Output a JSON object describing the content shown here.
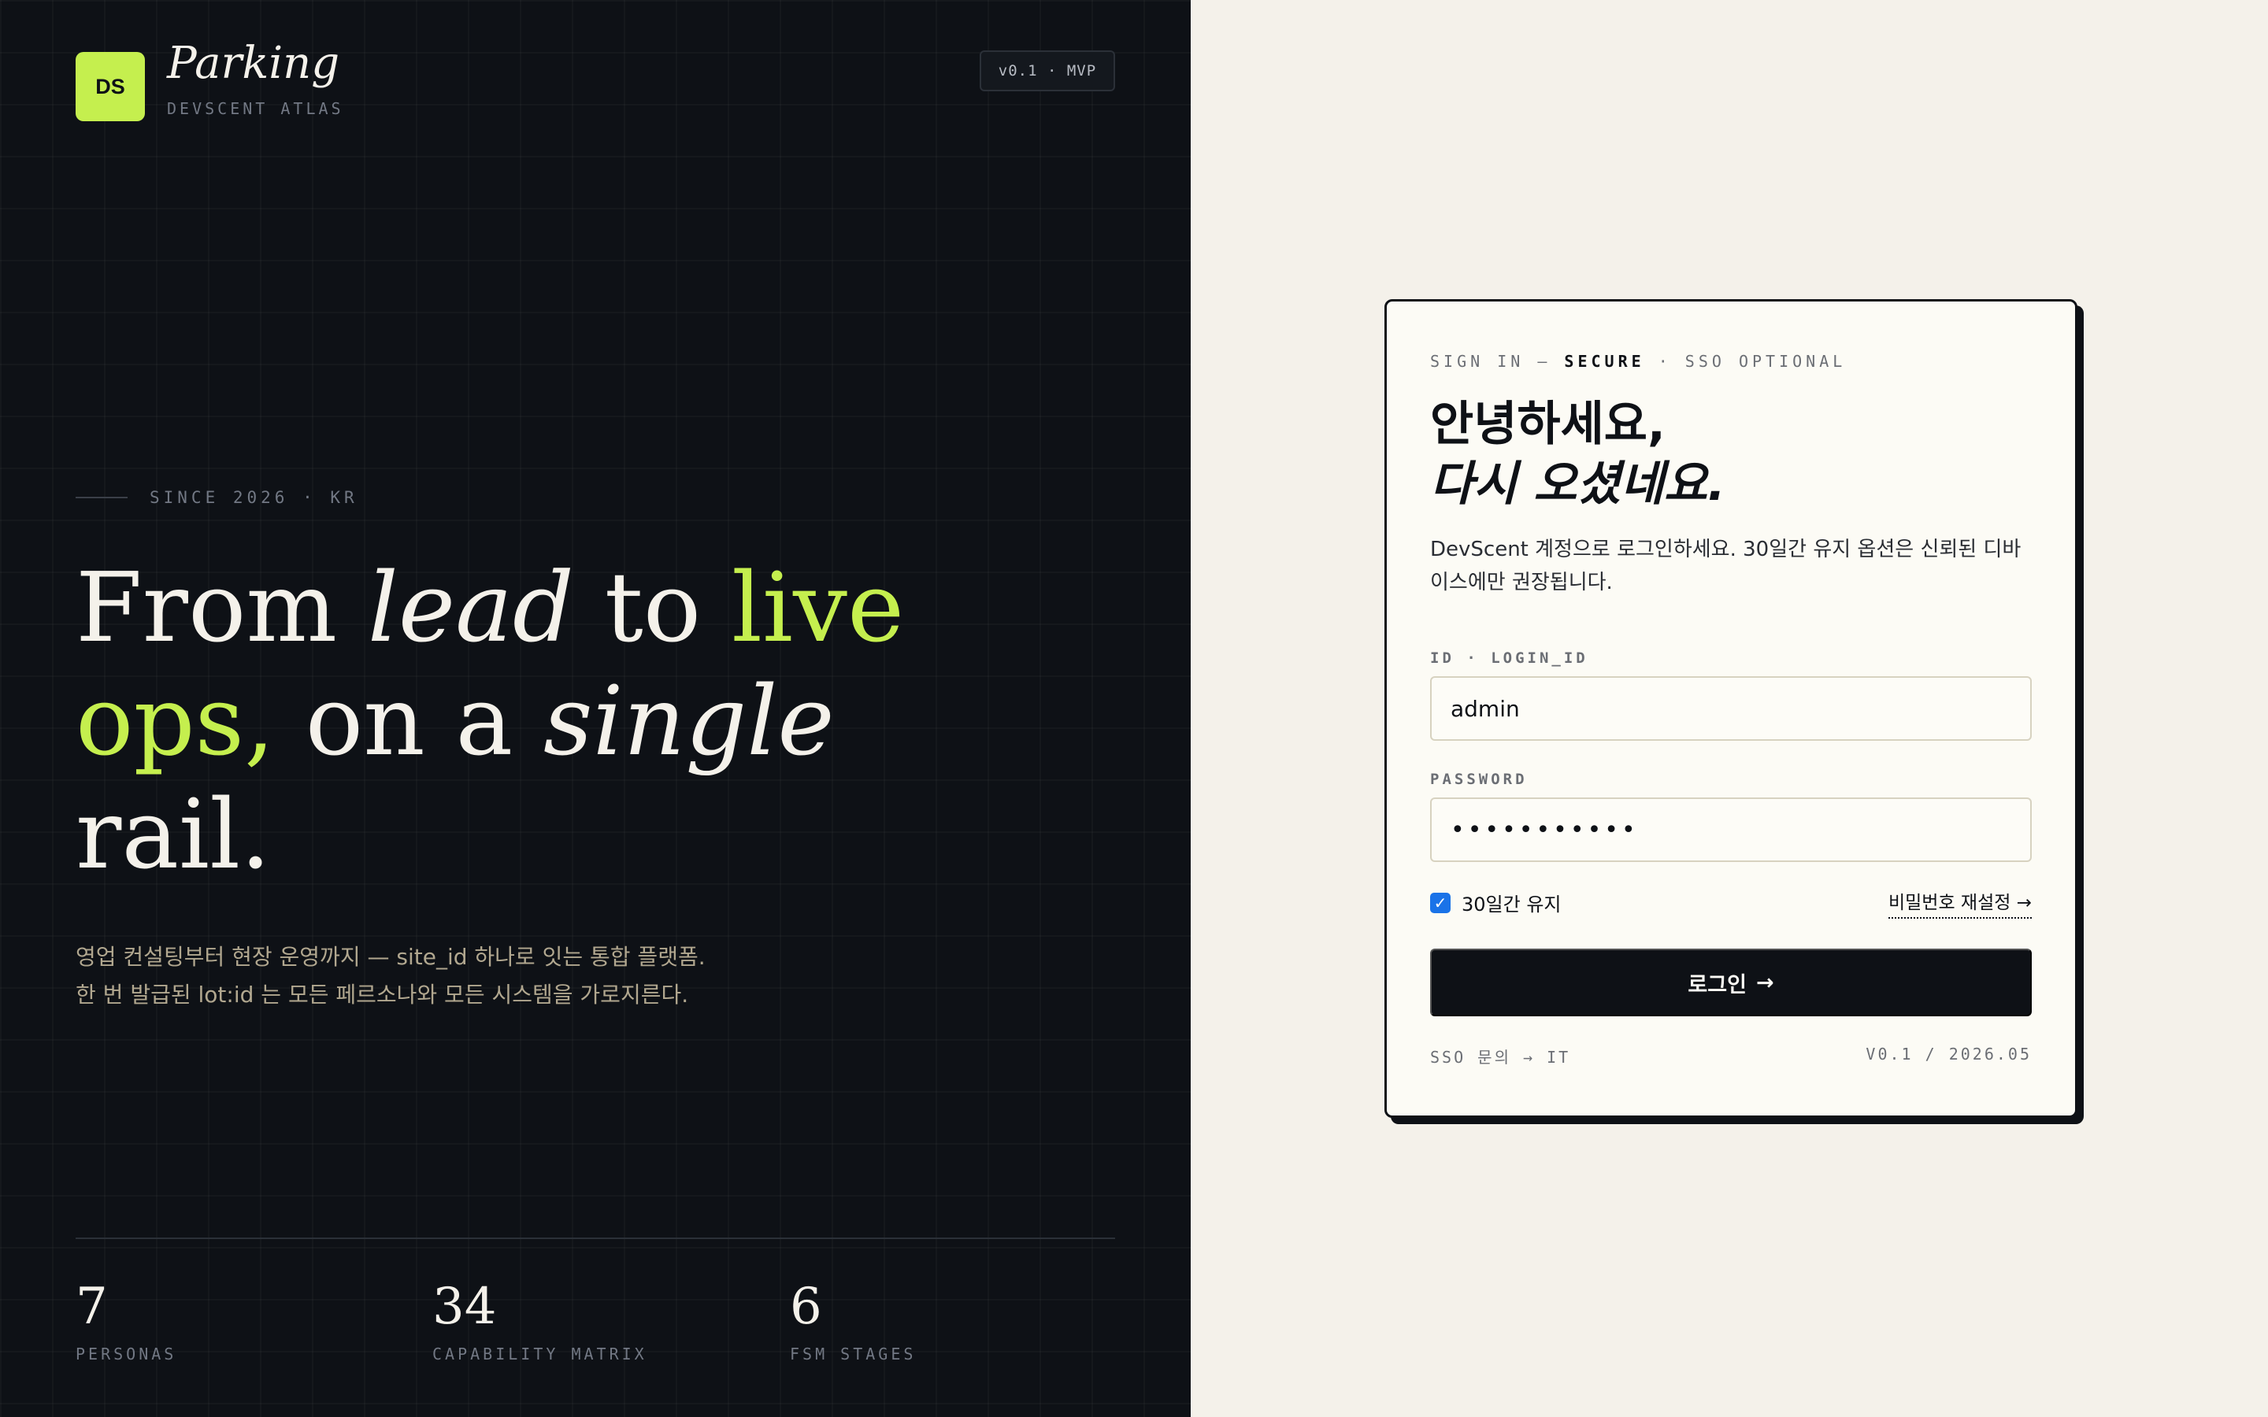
{
  "brand": {
    "badge": "DS",
    "name": "Parking",
    "subtitle": "DEVSCENT ATLAS",
    "version": "v0.1 · MVP"
  },
  "hero": {
    "eyebrow": "SINCE 2026 · KR",
    "line1": {
      "a": "From ",
      "b": "lead",
      "c": " to ",
      "d": "live"
    },
    "line2": {
      "a": "ops,",
      "b": " on a ",
      "c": "single"
    },
    "line3": "rail.",
    "lede": "영업 컨설팅부터 현장 운영까지 — site_id 하나로 잇는 통합 플랫폼. 한 번 발급된 lot:id 는 모든 페르소나와 모든 시스템을 가로지른다."
  },
  "stats": [
    {
      "value": "7",
      "label": "PERSONAS"
    },
    {
      "value": "34",
      "label": "CAPABILITY MATRIX"
    },
    {
      "value": "6",
      "label": "FSM STAGES"
    }
  ],
  "login": {
    "eyebrow_pre": "SIGN IN — ",
    "eyebrow_strong": "SECURE",
    "eyebrow_post": " · SSO OPTIONAL",
    "greeting_line1": "안녕하세요,",
    "greeting_line2": "다시 오셨네요.",
    "description": "DevScent 계정으로 로그인하세요. 30일간 유지 옵션은 신뢰된 디바이스에만 권장됩니다.",
    "id_label": "ID · LOGIN_ID",
    "id_value": "admin",
    "password_label": "PASSWORD",
    "password_value": "•••••••••••",
    "remember_label": "30일간 유지",
    "remember_checked": true,
    "reset_link": "비밀번호 재설정 →",
    "submit_label": "로그인",
    "submit_arrow": "→",
    "footer_left": "SSO 문의 → IT",
    "footer_right": "V0.1 / 2026.05"
  },
  "colors": {
    "accent": "#c5ef4e",
    "dark": "#0e1116",
    "paper": "#f4f1ea",
    "checkbox": "#1a73e8"
  }
}
